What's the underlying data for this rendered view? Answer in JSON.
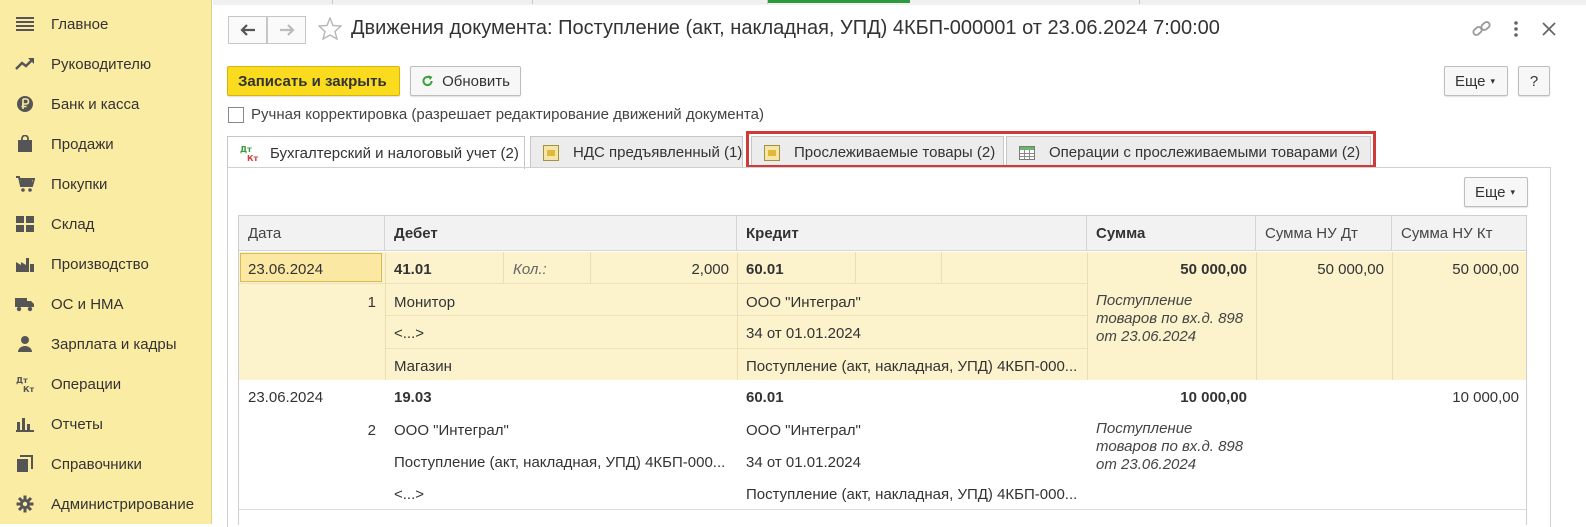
{
  "sidebar": {
    "items": [
      {
        "label": "Главное",
        "icon": "menu-icon"
      },
      {
        "label": "Руководителю",
        "icon": "trend-icon"
      },
      {
        "label": "Банк и касса",
        "icon": "ruble-coin-icon"
      },
      {
        "label": "Продажи",
        "icon": "shopping-bag-icon"
      },
      {
        "label": "Покупки",
        "icon": "cart-icon"
      },
      {
        "label": "Склад",
        "icon": "warehouse-icon"
      },
      {
        "label": "Производство",
        "icon": "factory-icon"
      },
      {
        "label": "ОС и НМА",
        "icon": "truck-icon"
      },
      {
        "label": "Зарплата и кадры",
        "icon": "person-icon"
      },
      {
        "label": "Операции",
        "icon": "dt-kt-icon"
      },
      {
        "label": "Отчеты",
        "icon": "bar-chart-icon"
      },
      {
        "label": "Справочники",
        "icon": "books-icon"
      },
      {
        "label": "Администрирование",
        "icon": "gear-icon"
      }
    ]
  },
  "header": {
    "title": "Движения документа: Поступление (акт, накладная, УПД) 4КБП-000001 от 23.06.2024 7:00:00"
  },
  "toolbar": {
    "save_close": "Записать и закрыть",
    "refresh": "Обновить",
    "more": "Еще",
    "help": "?"
  },
  "manual_correction": {
    "label": "Ручная корректировка (разрешает редактирование движений документа)",
    "checked": false
  },
  "tabs": [
    {
      "label": "Бухгалтерский и налоговый учет (2)",
      "icon": "dt-kt-icon",
      "active": true
    },
    {
      "label": "НДС предъявленный (1)",
      "icon": "register-icon",
      "active": false
    },
    {
      "label": "Прослеживаемые товары (2)",
      "icon": "register-icon",
      "active": false
    },
    {
      "label": "Операции с прослеживаемыми товарами (2)",
      "icon": "table-icon",
      "active": false
    }
  ],
  "panel": {
    "more": "Еще"
  },
  "grid": {
    "columns": [
      "Дата",
      "Дебет",
      "Кредит",
      "Сумма",
      "Сумма НУ Дт",
      "Сумма НУ Кт"
    ],
    "rows": [
      {
        "date": "23.06.2024",
        "number": "1",
        "debit_account": "41.01",
        "qty_label": "Кол.:",
        "qty": "2,000",
        "debit_sub1": "Монитор",
        "debit_sub2": "<...>",
        "debit_sub3": "Магазин",
        "credit_account": "60.01",
        "credit_sub1": "ООО \"Интеграл\"",
        "credit_sub2": "34 от 01.01.2024",
        "credit_sub3": "Поступление (акт, накладная, УПД) 4КБП-000...",
        "amount": "50 000,00",
        "content": "Поступление товаров по вх.д. 898 от 23.06.2024",
        "nu_dt": "50 000,00",
        "nu_kt": "50 000,00"
      },
      {
        "date": "23.06.2024",
        "number": "2",
        "debit_account": "19.03",
        "debit_sub1": "ООО \"Интеграл\"",
        "debit_sub2": "Поступление (акт, накладная, УПД) 4КБП-000...",
        "debit_sub3": "<...>",
        "credit_account": "60.01",
        "credit_sub1": "ООО \"Интеграл\"",
        "credit_sub2": "34 от 01.01.2024",
        "credit_sub3": "Поступление (акт, накладная, УПД) 4КБП-000...",
        "amount": "10 000,00",
        "content": "Поступление товаров по вх.д. 898 от 23.06.2024",
        "nu_dt": "",
        "nu_kt": "10 000,00"
      }
    ]
  },
  "colors": {
    "sidebar_bg": "#fbeca4",
    "primary_button": "#fbdb1e",
    "selected_row": "#fcf2cc",
    "highlight_frame": "#d23a3a",
    "active_tab_indicator": "#2c9b3e"
  }
}
